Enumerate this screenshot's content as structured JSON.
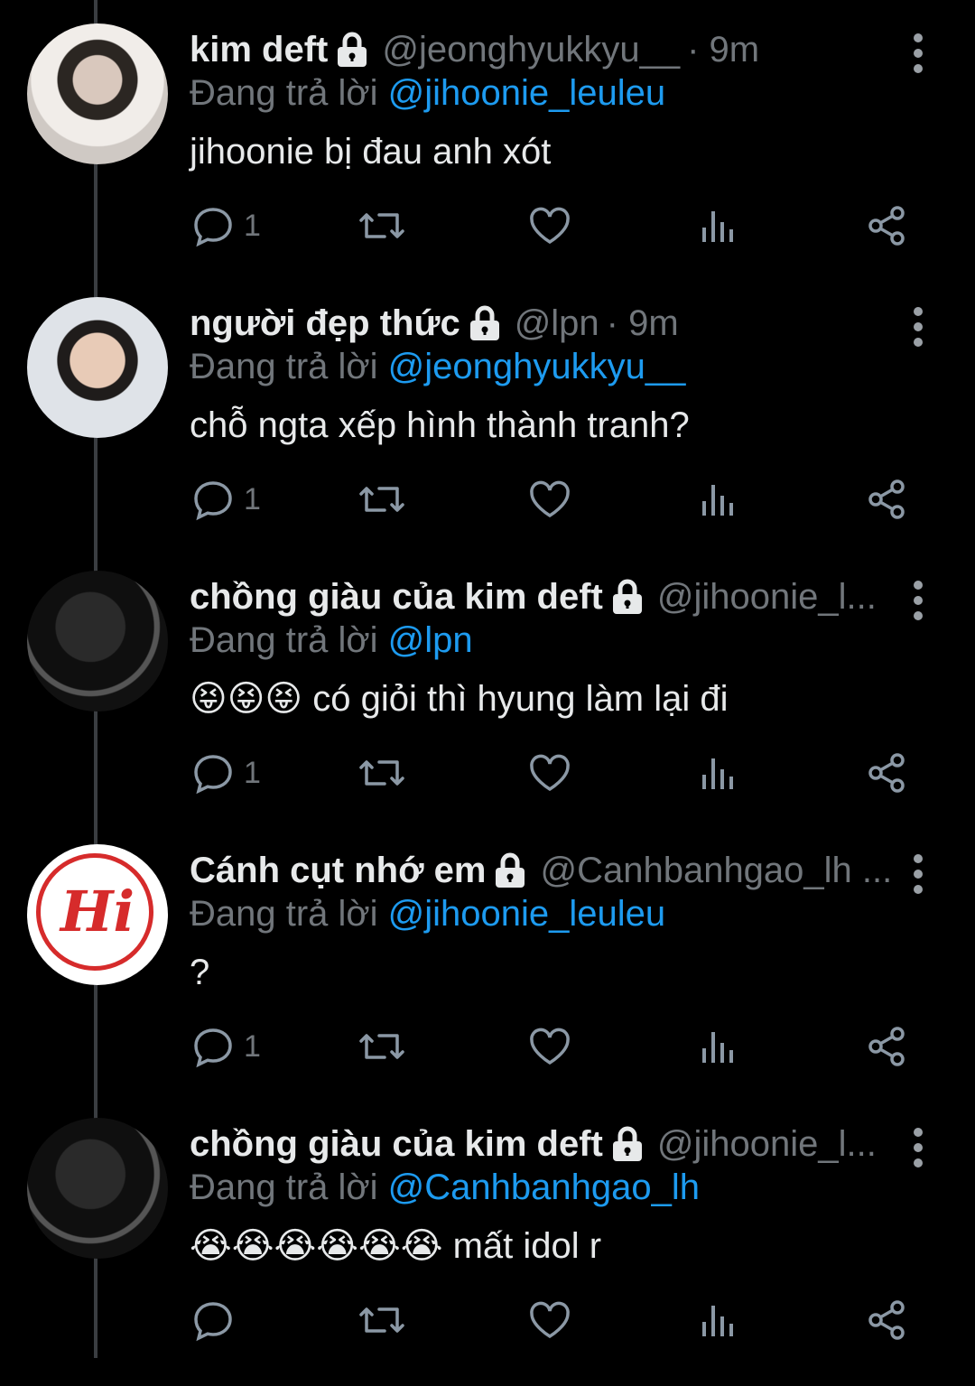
{
  "colors": {
    "background": "#000000",
    "text": "#e7e9ea",
    "muted": "#71767b",
    "link": "#1d9bf0",
    "thread_line": "#3a3d41"
  },
  "tweets": [
    {
      "name": "kim deft",
      "handle": "@jeonghyukkyu__",
      "time": "· 9m",
      "replying_label": "Đang trả lời",
      "mention": "@jihoonie_leuleu",
      "text": "jihoonie bị đau anh xót",
      "emojis": "",
      "reply_count": "1",
      "avatar": "photo-boy-jersey",
      "locked": true
    },
    {
      "name": "người đẹp thức",
      "handle": "@lpn",
      "time": "· 9m",
      "replying_label": "Đang trả lời",
      "mention": "@jeonghyukkyu__",
      "text": "chỗ ngta xếp hình thành tranh?",
      "emojis": "",
      "reply_count": "1",
      "avatar": "photo-boy-funny-face",
      "locked": true
    },
    {
      "name": "chồng giàu của kim deft",
      "handle": "@jihoonie_l...",
      "time": "",
      "replying_label": "Đang trả lời",
      "mention": "@lpn",
      "text": "có giỏi thì hyung làm lại đi",
      "emojis": "😝😝😝",
      "reply_count": "1",
      "avatar": "photo-dark-hooded",
      "locked": true
    },
    {
      "name": "Cánh cụt nhớ em",
      "handle": "@Canhbanhgao_lh ...",
      "time": "",
      "replying_label": "Đang trả lời",
      "mention": "@jihoonie_leuleu",
      "text": "?",
      "emojis": "",
      "reply_count": "1",
      "avatar": "logo-hi",
      "avatar_text": "Hi",
      "locked": true
    },
    {
      "name": "chồng giàu của kim deft",
      "handle": "@jihoonie_l...",
      "time": "",
      "replying_label": "Đang trả lời",
      "mention": "@Canhbanhgao_lh",
      "text": "mất idol r",
      "emojis": "😭😭😭😭😭😭",
      "reply_count": "",
      "avatar": "photo-dark-hooded",
      "locked": true
    }
  ],
  "icons": {
    "reply": "reply-bubble-icon",
    "retweet": "retweet-icon",
    "like": "heart-icon",
    "views": "bar-chart-icon",
    "share": "share-icon",
    "more": "more-vertical-icon",
    "lock": "lock-icon"
  }
}
